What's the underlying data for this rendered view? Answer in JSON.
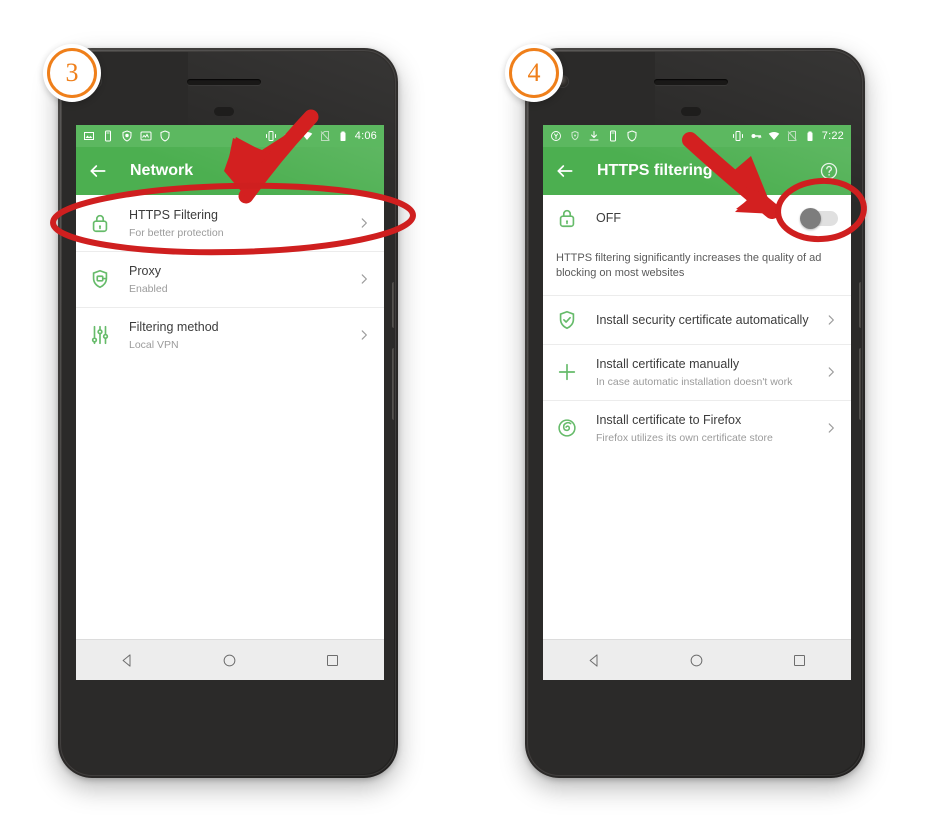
{
  "page": {
    "background": "#ffffff",
    "accent_green": "#4caf50",
    "statusbar_green": "#5cb860",
    "annotation_red": "#d32020",
    "badge_orange": "#ef7f1a"
  },
  "steps": [
    {
      "number": "3"
    },
    {
      "number": "4"
    }
  ],
  "phone1": {
    "statusbar": {
      "left_icons": [
        "image-icon",
        "phone-icon",
        "shield-icon",
        "stats-icon",
        "shield-outline-icon"
      ],
      "right_icons": [
        "vibrate-icon",
        "vpn-key-icon",
        "wifi-icon",
        "no-sim-icon",
        "battery-icon"
      ],
      "time": "4:06"
    },
    "appbar": {
      "back_icon": "back-arrow-icon",
      "title": "Network"
    },
    "rows": [
      {
        "icon": "lock-shield-icon",
        "title": "HTTPS Filtering",
        "subtitle": "For better protection",
        "chevron": "chevron-right-icon"
      },
      {
        "icon": "proxy-shield-icon",
        "title": "Proxy",
        "subtitle": "Enabled",
        "chevron": "chevron-right-icon"
      },
      {
        "icon": "sliders-icon",
        "title": "Filtering method",
        "subtitle": "Local VPN",
        "chevron": "chevron-right-icon"
      }
    ],
    "navbar": [
      "back-triangle-icon",
      "home-circle-icon",
      "recents-square-icon"
    ]
  },
  "phone2": {
    "statusbar": {
      "left_icons": [
        "yandex-icon",
        "shield-small-icon",
        "download-icon",
        "phone-icon",
        "shield-outline-icon"
      ],
      "right_icons": [
        "vibrate-icon",
        "vpn-key-icon",
        "wifi-icon",
        "no-sim-icon",
        "battery-icon"
      ],
      "time": "7:22"
    },
    "appbar": {
      "back_icon": "back-arrow-icon",
      "title": "HTTPS filtering",
      "help_icon": "help-circle-icon"
    },
    "toggle_row": {
      "icon": "lock-shield-icon",
      "label": "OFF",
      "toggle_state": "off"
    },
    "description": "HTTPS filtering significantly increases the quality of ad blocking on most websites",
    "rows": [
      {
        "icon": "shield-check-icon",
        "title": "Install security certificate automatically",
        "subtitle": "",
        "chevron": "chevron-right-icon"
      },
      {
        "icon": "plus-icon",
        "title": "Install certificate manually",
        "subtitle": "In case automatic installation doesn't work",
        "chevron": "chevron-right-icon"
      },
      {
        "icon": "firefox-icon",
        "title": "Install certificate to Firefox",
        "subtitle": "Firefox utilizes its own certificate store",
        "chevron": "chevron-right-icon"
      }
    ],
    "navbar": [
      "back-triangle-icon",
      "home-circle-icon",
      "recents-square-icon"
    ]
  },
  "annotations": {
    "arrow1": "red-arrow-pointing-to-https-filtering-row",
    "ellipse1": "red-ellipse-highlighting-https-filtering-row",
    "arrow2": "red-arrow-pointing-to-toggle",
    "ellipse2": "red-ellipse-highlighting-toggle"
  }
}
